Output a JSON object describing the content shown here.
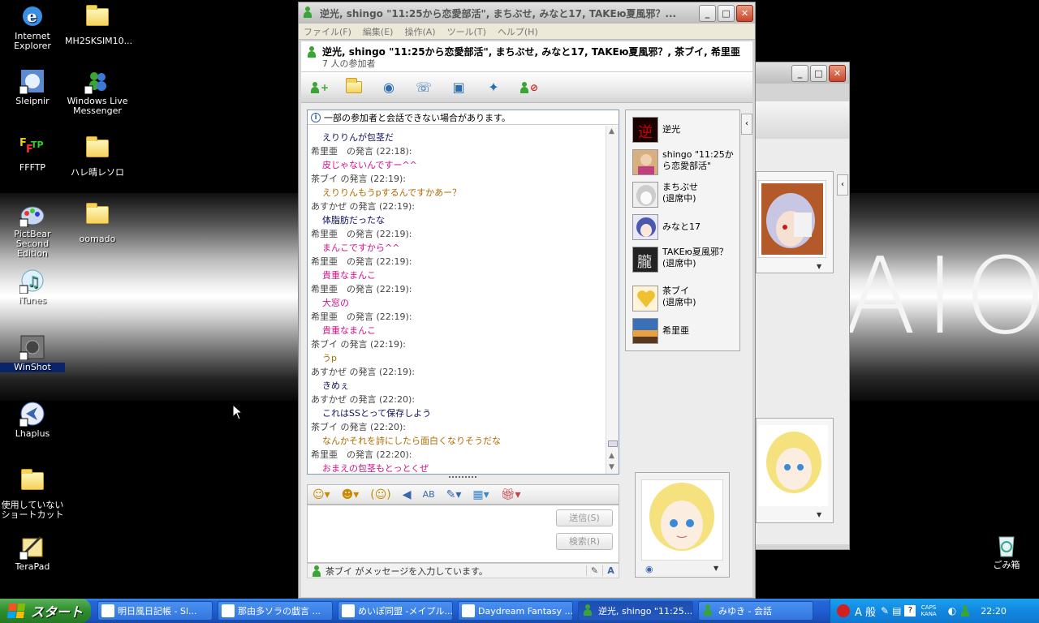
{
  "desktop": {
    "icons": [
      {
        "label": "Internet Explorer"
      },
      {
        "label": "MH2SKSIM10..."
      },
      {
        "label": "Sleipnir"
      },
      {
        "label": "Windows Live Messenger"
      },
      {
        "label": "FFFTP"
      },
      {
        "label": "ハレ晴レソロ"
      },
      {
        "label": "PictBear Second Edition"
      },
      {
        "label": "oomado"
      },
      {
        "label": "iTunes"
      },
      {
        "label": "WinShot"
      },
      {
        "label": "Lhaplus"
      },
      {
        "label": "使用していない ショートカット"
      },
      {
        "label": "TeraPad"
      },
      {
        "label": "ごみ箱"
      }
    ],
    "brand": "AIO"
  },
  "chat_window": {
    "title": "逆光, shingo \"11:25から恋愛部活\", まちぶせ, みなと17, TAKEю夏風邪？...",
    "menu": [
      "ファイル(F)",
      "編集(E)",
      "操作(A)",
      "ツール(T)",
      "ヘルプ(H)"
    ],
    "header_title": "逆光, shingo \"11:25から恋愛部活\", まちぶせ, みなと17, TAKEю夏風邪？, 茶ブイ, 希里亜",
    "participant_count": "7 人の参加者",
    "info_notice": "一部の参加者と会話できない場合があります。",
    "messages": [
      {
        "kind": "text",
        "text": "えりりんが包茎だ",
        "color": "navy"
      },
      {
        "kind": "speaker",
        "text": "希里亜　の発言 (22:18):"
      },
      {
        "kind": "text",
        "text": "皮じゃないんですー^^",
        "color": "pink"
      },
      {
        "kind": "speaker",
        "text": "茶ブイ の発言 (22:19):"
      },
      {
        "kind": "text",
        "text": "えりりんもうpするんですかあー？",
        "color": "orange"
      },
      {
        "kind": "speaker",
        "text": "あすかぜ の発言 (22:19):"
      },
      {
        "kind": "text",
        "text": "体脂肪だったな",
        "color": "navy"
      },
      {
        "kind": "speaker",
        "text": "希里亜　の発言 (22:19):"
      },
      {
        "kind": "text",
        "text": "まんこですから^^",
        "color": "pink"
      },
      {
        "kind": "speaker",
        "text": "希里亜　の発言 (22:19):"
      },
      {
        "kind": "text",
        "text": "貴重なまんこ",
        "color": "pink"
      },
      {
        "kind": "speaker",
        "text": "希里亜　の発言 (22:19):"
      },
      {
        "kind": "text",
        "text": "大窓の",
        "color": "pink"
      },
      {
        "kind": "speaker",
        "text": "希里亜　の発言 (22:19):"
      },
      {
        "kind": "text",
        "text": "貴重なまんこ",
        "color": "pink"
      },
      {
        "kind": "speaker",
        "text": "茶ブイ の発言 (22:19):"
      },
      {
        "kind": "text",
        "text": "うp",
        "color": "orange"
      },
      {
        "kind": "speaker",
        "text": "あすかぜ の発言 (22:19):"
      },
      {
        "kind": "text",
        "text": "きめぇ",
        "color": "navy"
      },
      {
        "kind": "speaker",
        "text": "あすかぜ の発言 (22:20):"
      },
      {
        "kind": "text",
        "text": "これはSSとって保存しよう",
        "color": "navy"
      },
      {
        "kind": "speaker",
        "text": "茶ブイ の発言 (22:20):"
      },
      {
        "kind": "text",
        "text": "なんかそれを詩にしたら面白くなりそうだな",
        "color": "orange"
      },
      {
        "kind": "speaker",
        "text": "希里亜　の発言 (22:20):"
      },
      {
        "kind": "text",
        "text": "おまえの包茎もとっとくぜ",
        "color": "pink"
      }
    ],
    "participants": [
      {
        "name": "逆光",
        "status": ""
      },
      {
        "name": "shingo \"11:25から恋愛部活\"",
        "status": ""
      },
      {
        "name": "まちぶせ",
        "status": "(退席中)"
      },
      {
        "name": "みなと17",
        "status": ""
      },
      {
        "name": "TAKEю夏風邪？",
        "status": "(退席中)"
      },
      {
        "name": "茶ブイ",
        "status": "(退席中)"
      },
      {
        "name": "希里亜",
        "status": ""
      }
    ],
    "send_label": "送信(S)",
    "search_label": "検索(R)",
    "typing_status": "茶ブイ がメッセージを入力しています。",
    "colors": {
      "navy": "#101060",
      "pink": "#d0108a",
      "orange": "#b06a00"
    }
  },
  "taskbar": {
    "start_label": "スタート",
    "tasks": [
      "明日風日記帳 - Sl...",
      "那由多ソラの戯言 ...",
      "めいぽ同盟 -メイプル...",
      "Daydream Fantasy ...",
      "逆光, shingo \"11:25...",
      "みゆき - 会話"
    ],
    "ime": "A 般",
    "caps": "CAPS",
    "kana": "KANA",
    "clock": "22:20"
  }
}
